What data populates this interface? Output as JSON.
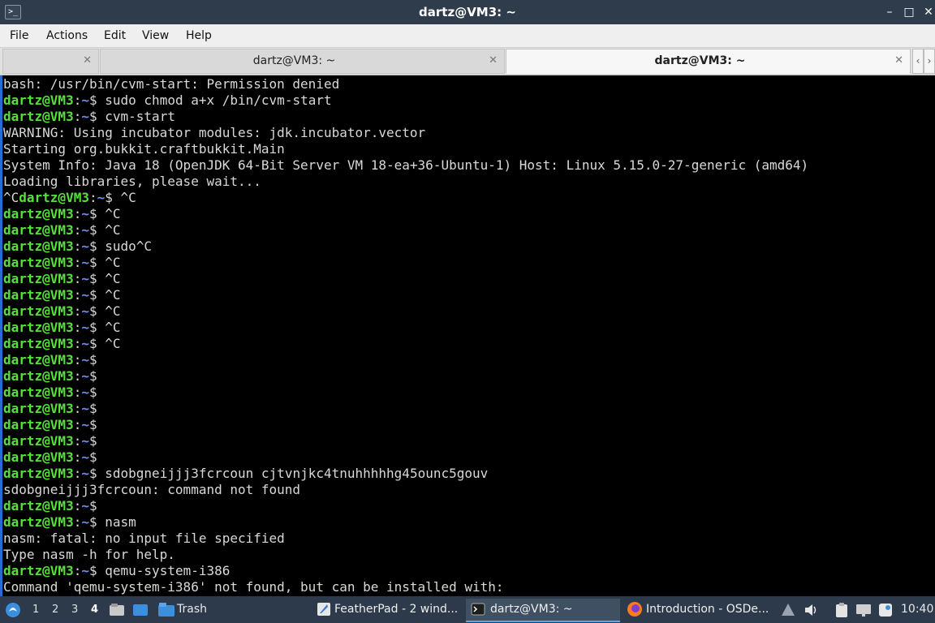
{
  "window": {
    "title": "dartz@VM3: ~",
    "app_icon": ">_",
    "minimize": "–",
    "maximize": "□",
    "close": "✕"
  },
  "menu": [
    "File",
    "Actions",
    "Edit",
    "View",
    "Help"
  ],
  "tabs": [
    {
      "label": "",
      "close": "✕"
    },
    {
      "label": "dartz@VM3: ~",
      "close": "✕"
    },
    {
      "label": "dartz@VM3: ~",
      "close": "✕",
      "active": true
    }
  ],
  "tab_scroll": {
    "left": "‹",
    "right": "›"
  },
  "prompt": {
    "user": "dartz@VM3",
    "sep": ":",
    "path": "~",
    "sym": "$"
  },
  "terminal_lines": [
    {
      "text": "bash: /usr/bin/cvm-start: Permission denied"
    },
    {
      "prompt": true,
      "cmd": " sudo chmod a+x /bin/cvm-start"
    },
    {
      "prompt": true,
      "cmd": " cvm-start"
    },
    {
      "text": "WARNING: Using incubator modules: jdk.incubator.vector"
    },
    {
      "text": "Starting org.bukkit.craftbukkit.Main"
    },
    {
      "text": "System Info: Java 18 (OpenJDK 64-Bit Server VM 18-ea+36-Ubuntu-1) Host: Linux 5.15.0-27-generic (amd64)"
    },
    {
      "text": "Loading libraries, please wait..."
    },
    {
      "prefix": "^C",
      "prompt": true,
      "cmd": " ^C"
    },
    {
      "prompt": true,
      "cmd": " ^C"
    },
    {
      "prompt": true,
      "cmd": " ^C"
    },
    {
      "prompt": true,
      "cmd": " sudo^C"
    },
    {
      "prompt": true,
      "cmd": " ^C"
    },
    {
      "prompt": true,
      "cmd": " ^C"
    },
    {
      "prompt": true,
      "cmd": " ^C"
    },
    {
      "prompt": true,
      "cmd": " ^C"
    },
    {
      "prompt": true,
      "cmd": " ^C"
    },
    {
      "prompt": true,
      "cmd": " ^C"
    },
    {
      "prompt": true,
      "cmd": ""
    },
    {
      "prompt": true,
      "cmd": ""
    },
    {
      "prompt": true,
      "cmd": ""
    },
    {
      "prompt": true,
      "cmd": ""
    },
    {
      "prompt": true,
      "cmd": ""
    },
    {
      "prompt": true,
      "cmd": ""
    },
    {
      "prompt": true,
      "cmd": ""
    },
    {
      "prompt": true,
      "cmd": " sdobgneijjj3fcrcoun cjtvnjkc4tnuhhhhhg45ounc5gouv"
    },
    {
      "text": "sdobgneijjj3fcrcoun: command not found"
    },
    {
      "prompt": true,
      "cmd": ""
    },
    {
      "prompt": true,
      "cmd": " nasm"
    },
    {
      "text": "nasm: fatal: no input file specified"
    },
    {
      "text": "Type nasm -h for help."
    },
    {
      "prompt": true,
      "cmd": " qemu-system-i386"
    },
    {
      "text": "Command 'qemu-system-i386' not found, but can be installed with:"
    }
  ],
  "taskbar": {
    "workspaces": [
      "1",
      "2",
      "3",
      "4"
    ],
    "current_workspace": "4",
    "trash_label": "Trash",
    "tasks": [
      {
        "label": "FeatherPad - 2 wind...",
        "icon": "featherpad-icon"
      },
      {
        "label": "dartz@VM3: ~",
        "icon": "terminal-icon",
        "active": true
      },
      {
        "label": "Introduction - OSDe...",
        "icon": "firefox-icon"
      }
    ],
    "clock": "10:40"
  },
  "colors": {
    "prompt_user": "#55e03a",
    "prompt_path": "#6d8ff0",
    "terminal_bg": "#000000",
    "terminal_fg": "#d8d8d8",
    "titlebar_bg": "#2e3c4c",
    "taskbar_bg": "#2d3a4b"
  }
}
